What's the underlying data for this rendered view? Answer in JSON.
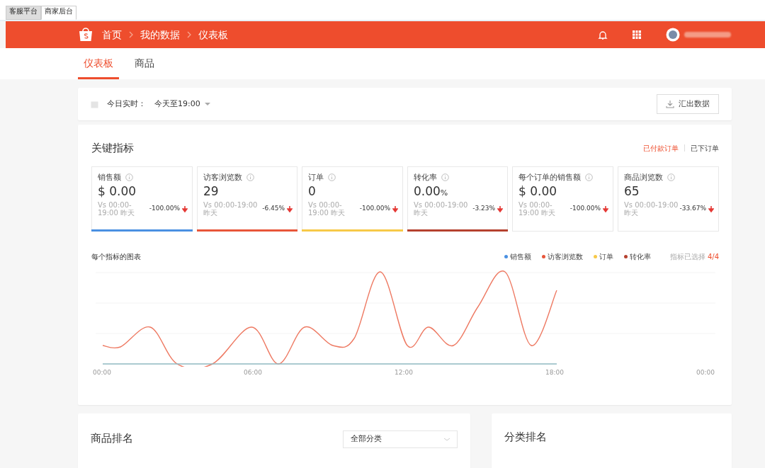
{
  "window_tabs": [
    {
      "label": "客服平台",
      "selected": false
    },
    {
      "label": "商家后台",
      "selected": true
    }
  ],
  "header": {
    "breadcrumb": [
      "首页",
      "我的数据",
      "仪表板"
    ]
  },
  "nav_tabs": [
    {
      "label": "仪表板",
      "selected": true
    },
    {
      "label": "商品",
      "selected": false
    }
  ],
  "filter": {
    "label": "今日实时：",
    "value": "今天至19:00",
    "export_button": "汇出数据"
  },
  "key_metrics": {
    "title": "关键指标",
    "order_types": [
      {
        "label": "已付款订单",
        "selected": true
      },
      {
        "label": "已下订单",
        "selected": false
      }
    ],
    "cards": [
      {
        "name": "销售额",
        "value": "$ 0.00",
        "compare": "Vs 00:00-19:00 昨天",
        "change": "-100.00%",
        "selected": true,
        "color": "#4a90e2"
      },
      {
        "name": "访客浏览数",
        "value": "29",
        "compare": "Vs 00:00-19:00 昨天",
        "change": "-6.45%",
        "selected": true,
        "color": "#e8563a"
      },
      {
        "name": "订单",
        "value": "0",
        "compare": "Vs 00:00-19:00 昨天",
        "change": "-100.00%",
        "selected": true,
        "color": "#f7c948"
      },
      {
        "name": "转化率",
        "value": "0.00",
        "unit": "%",
        "compare": "Vs 00:00-19:00 昨天",
        "change": "-3.23%",
        "selected": true,
        "color": "#b5412f"
      },
      {
        "name": "每个订单的销售额",
        "value": "$ 0.00",
        "compare": "Vs 00:00-19:00 昨天",
        "change": "-100.00%",
        "selected": false
      },
      {
        "name": "商品浏览数",
        "value": "65",
        "compare": "Vs 00:00-19:00 昨天",
        "change": "-33.67%",
        "selected": false
      }
    ],
    "chart": {
      "title": "每个指标的图表",
      "legend": [
        {
          "label": "销售额",
          "color": "#4a90e2"
        },
        {
          "label": "访客浏览数",
          "color": "#e8563a"
        },
        {
          "label": "订单",
          "color": "#f7c948"
        },
        {
          "label": "转化率",
          "color": "#b5412f"
        }
      ],
      "selected_label": "指标已选择",
      "selected_count": "4/4",
      "xticks": [
        "00:00",
        "06:00",
        "12:00",
        "18:00",
        "00:00"
      ]
    }
  },
  "product_ranking": {
    "title": "商品排名",
    "category_select": "全部分类"
  },
  "category_ranking": {
    "title": "分类排名"
  }
}
